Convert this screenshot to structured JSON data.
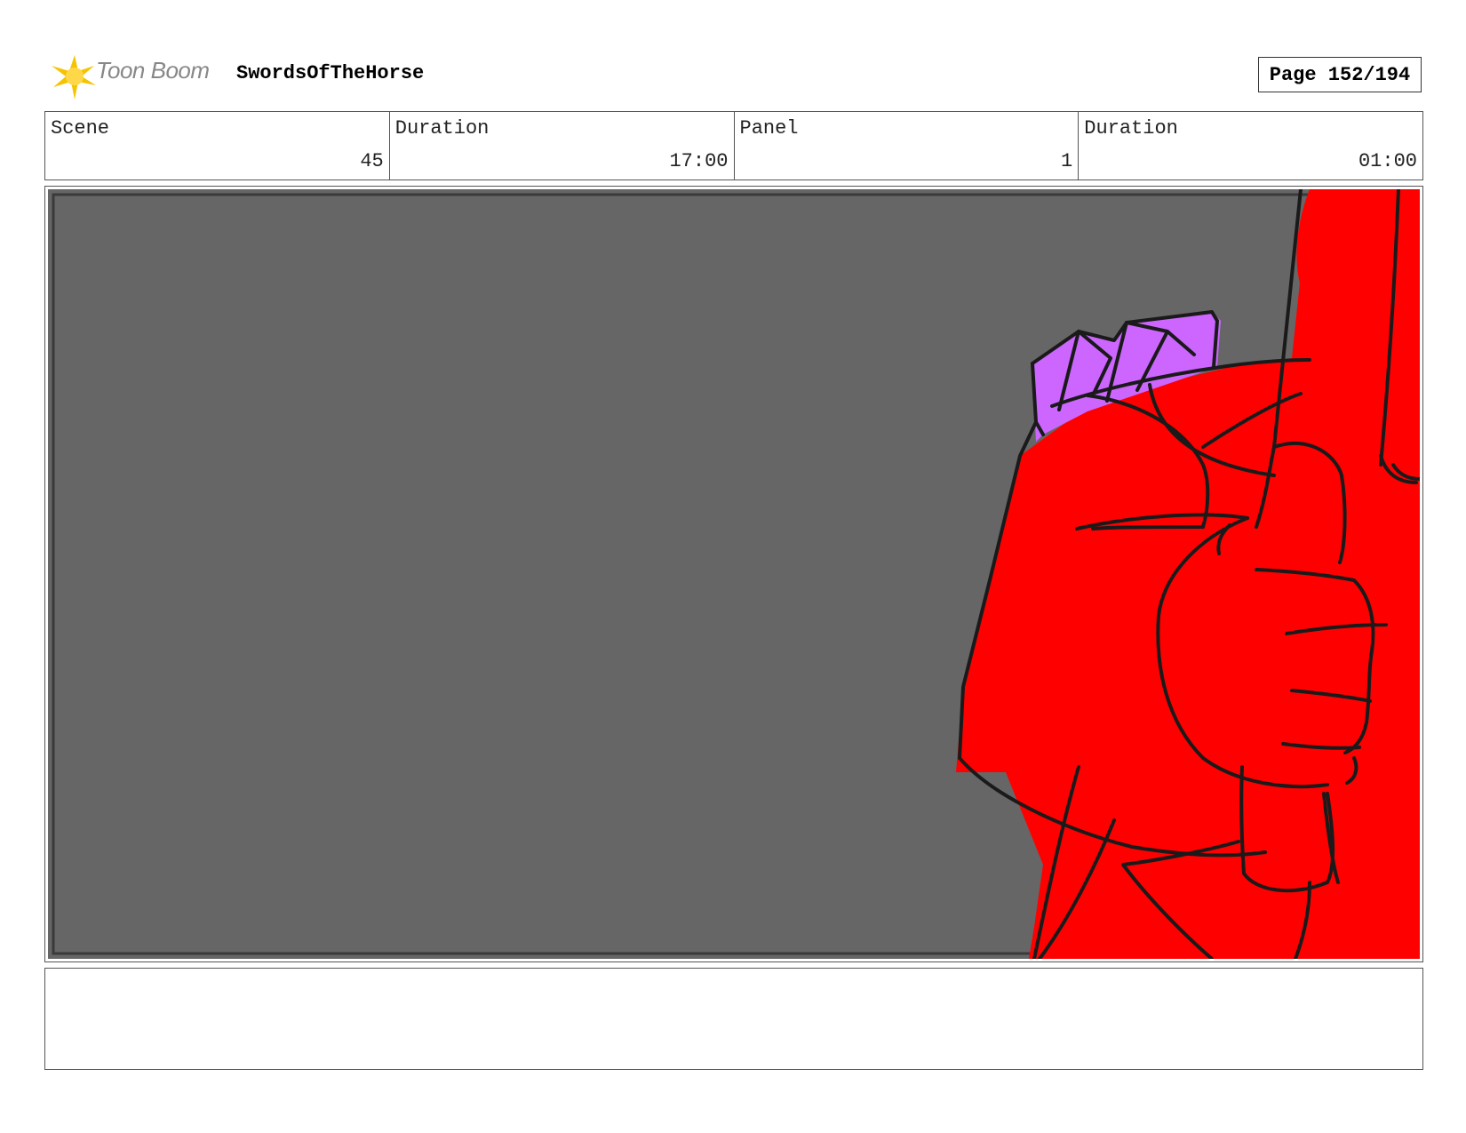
{
  "header": {
    "logo_text": "Toon Boom",
    "project_title": "SwordsOfTheHorse",
    "page_label": "Page 152/194"
  },
  "info": {
    "scene_label": "Scene",
    "scene_value": "45",
    "scene_duration_label": "Duration",
    "scene_duration_value": "17:00",
    "panel_label": "Panel",
    "panel_value": "1",
    "panel_duration_label": "Duration",
    "panel_duration_value": "01:00"
  },
  "colors": {
    "background_gray": "#666666",
    "character_red": "#ff0000",
    "gem_purple": "#cc66ff",
    "logo_yellow": "#f5c400"
  },
  "notes": {
    "text": ""
  }
}
